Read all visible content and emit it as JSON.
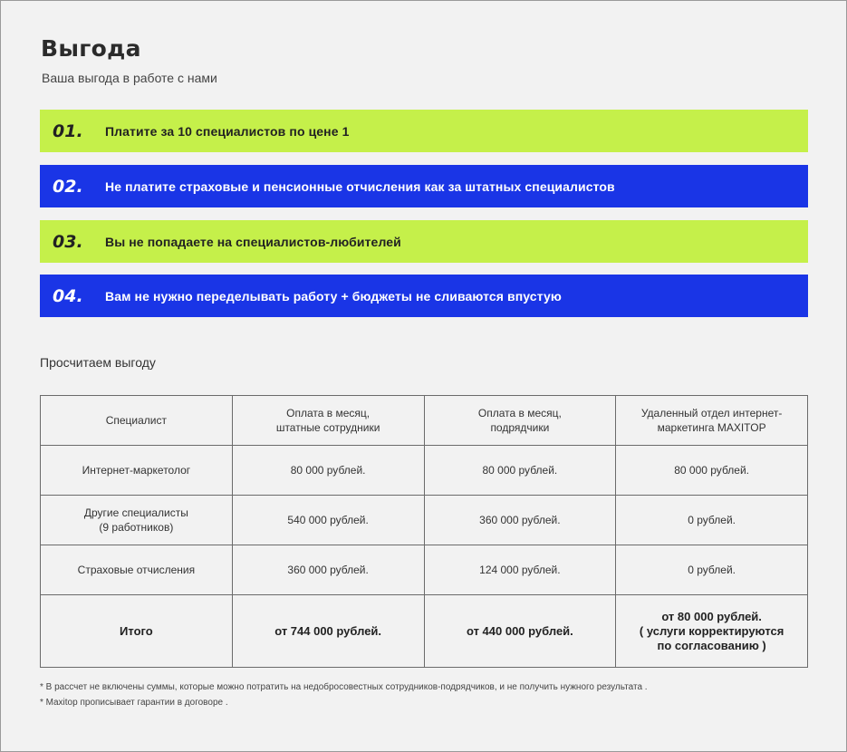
{
  "header": {
    "title": "Выгода",
    "subtitle": "Ваша выгода в работе с нами"
  },
  "benefits": [
    {
      "num": "01.",
      "text": "Платите за 10 специалистов по цене 1",
      "color": "#c5f04a"
    },
    {
      "num": "02.",
      "text": "Не платите страховые и пенсионные отчисления как за штатных специалистов",
      "color": "#1a35e6"
    },
    {
      "num": "03.",
      "text": "Вы не попадаете на специалистов-любителей",
      "color": "#c5f04a"
    },
    {
      "num": "04.",
      "text": "Вам не нужно переделывать работу + бюджеты не сливаются впустую",
      "color": "#1a35e6"
    }
  ],
  "calc": {
    "title": "Просчитаем выгоду",
    "headers": [
      "Специалист",
      "Оплата в месяц,\nштатные сотрудники",
      "Оплата в месяц,\nподрядчики",
      "Удаленный отдел интернет-\nмаркетинга MAXITOP"
    ],
    "rows": [
      [
        "Интернет-маркетолог",
        "80 000 рублей.",
        "80 000 рублей.",
        "80 000 рублей."
      ],
      [
        "Другие специалисты\n(9 работников)",
        "540 000 рублей.",
        "360 000 рублей.",
        "0 рублей."
      ],
      [
        "Страховые отчисления",
        "360 000 рублей.",
        "124 000 рублей.",
        "0 рублей."
      ]
    ],
    "total": [
      "Итого",
      "от 744 000 рублей.",
      "от 440 000 рублей.",
      "от 80 000 рублей.\n( услуги корректируются\nпо согласованию )"
    ]
  },
  "footnotes": [
    "* В рассчет не включены суммы, которые можно потратить на недобросовестных сотрудников-подрядчиков, и не получить нужного результата .",
    "* Maxitop прописывает гарантии в договоре ."
  ]
}
